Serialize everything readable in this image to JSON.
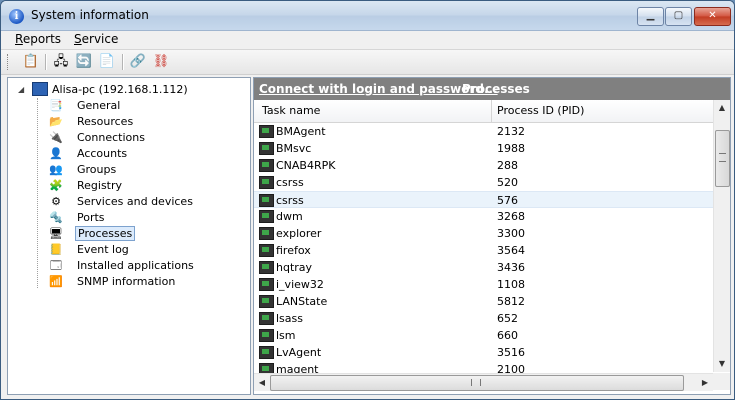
{
  "window": {
    "title": "System information",
    "icon": "info-icon"
  },
  "menu": [
    {
      "label": "Reports",
      "accel": "R",
      "rest": "eports"
    },
    {
      "label": "Service",
      "accel": "S",
      "rest": "ervice"
    }
  ],
  "toolbar": [
    {
      "name": "report-icon",
      "glyph": "📋"
    },
    {
      "name": "scan-icon",
      "glyph": "🖧"
    },
    {
      "name": "refresh-icon",
      "glyph": "🔄"
    },
    {
      "name": "copy-icon",
      "glyph": "📄"
    },
    {
      "name": "connect-icon",
      "glyph": "🔗"
    },
    {
      "name": "disconnect-icon",
      "glyph": "⛓"
    }
  ],
  "tree": {
    "root": "Alisa-pc (192.168.1.112)",
    "items": [
      {
        "label": "General",
        "icon": "general-icon",
        "glyph": "📑"
      },
      {
        "label": "Resources",
        "icon": "resources-icon",
        "glyph": "📂"
      },
      {
        "label": "Connections",
        "icon": "connections-icon",
        "glyph": "🔌"
      },
      {
        "label": "Accounts",
        "icon": "accounts-icon",
        "glyph": "👤"
      },
      {
        "label": "Groups",
        "icon": "groups-icon",
        "glyph": "👥"
      },
      {
        "label": "Registry",
        "icon": "registry-icon",
        "glyph": "🧩"
      },
      {
        "label": "Services and devices",
        "icon": "services-icon",
        "glyph": "⚙"
      },
      {
        "label": "Ports",
        "icon": "ports-icon",
        "glyph": "🔩"
      },
      {
        "label": "Processes",
        "icon": "processes-icon",
        "glyph": "🖥",
        "selected": true
      },
      {
        "label": "Event log",
        "icon": "event-log-icon",
        "glyph": "📒"
      },
      {
        "label": "Installed applications",
        "icon": "installed-apps-icon",
        "glyph": "🗔"
      },
      {
        "label": "SNMP information",
        "icon": "snmp-icon",
        "glyph": "📶"
      }
    ]
  },
  "content": {
    "link": "Connect with login and password...",
    "title": "Processes",
    "columns": [
      "Task name",
      "Process ID (PID)"
    ],
    "rows": [
      {
        "name": "BMAgent",
        "pid": "2132"
      },
      {
        "name": "BMsvc",
        "pid": "1988"
      },
      {
        "name": "CNAB4RPK",
        "pid": "288"
      },
      {
        "name": "csrss",
        "pid": "520"
      },
      {
        "name": "csrss",
        "pid": "576",
        "selected": true
      },
      {
        "name": "dwm",
        "pid": "3268"
      },
      {
        "name": "explorer",
        "pid": "3300"
      },
      {
        "name": "firefox",
        "pid": "3564"
      },
      {
        "name": "hqtray",
        "pid": "3436"
      },
      {
        "name": "i_view32",
        "pid": "1108"
      },
      {
        "name": "LANState",
        "pid": "5812"
      },
      {
        "name": "lsass",
        "pid": "652"
      },
      {
        "name": "lsm",
        "pid": "660"
      },
      {
        "name": "LvAgent",
        "pid": "3516"
      },
      {
        "name": "magent",
        "pid": "2100"
      }
    ]
  }
}
